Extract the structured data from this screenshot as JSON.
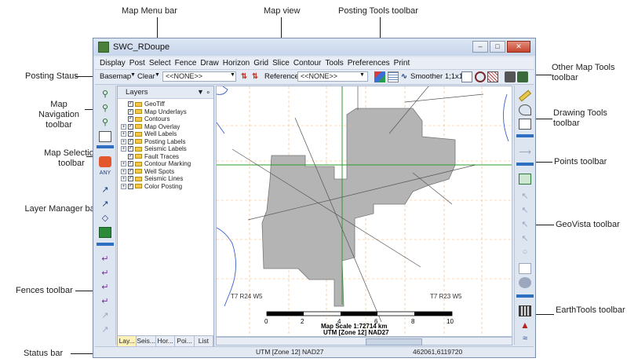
{
  "callouts": {
    "map_menu_bar": "Map Menu bar",
    "map_view": "Map view",
    "posting_tools_toolbar": "Posting Tools toolbar",
    "other_map_tools_toolbar": "Other Map Tools toolbar",
    "posting_status": "Posting Staus",
    "map_navigation_toolbar": "Map Navigation toolbar",
    "drawing_tools_toolbar": "Drawing Tools toolbar",
    "map_selection_toolbar": "Map Selection toolbar",
    "points_toolbar": "Points toolbar",
    "layer_manager_bar": "Layer Manager bar",
    "geovista_toolbar": "GeoVista toolbar",
    "fences_toolbar": "Fences toolbar",
    "earthtools_toolbar": "EarthTools toolbar",
    "status_bar": "Status bar"
  },
  "window": {
    "title": "SWC_RDoupe"
  },
  "menu": [
    "Display",
    "Post",
    "Select",
    "Fence",
    "Draw",
    "Horizon",
    "Grid",
    "Slice",
    "Contour",
    "Tools",
    "Preferences",
    "Print"
  ],
  "posting_bar": {
    "basemap": "Basemap",
    "clear": "Clear",
    "none_left": "<<NONE>>",
    "reference_label": "Reference:",
    "none_right": "<<NONE>>",
    "smoother": "Smoother 1;1x1"
  },
  "layers": {
    "title": "Layers",
    "items": [
      {
        "label": "GeoTiff",
        "expandable": false
      },
      {
        "label": "Map Underlays",
        "expandable": false
      },
      {
        "label": "Contours",
        "expandable": false
      },
      {
        "label": "Map Overlay",
        "expandable": true
      },
      {
        "label": "Well Labels",
        "expandable": true
      },
      {
        "label": "Posting Labels",
        "expandable": true
      },
      {
        "label": "Seismic Labels",
        "expandable": true
      },
      {
        "label": "Fault Traces",
        "expandable": false
      },
      {
        "label": "Contour Marking",
        "expandable": true
      },
      {
        "label": "Well Spots",
        "expandable": true
      },
      {
        "label": "Seismic Lines",
        "expandable": true
      },
      {
        "label": "Color Posting",
        "expandable": true
      }
    ],
    "tabs": [
      "Lay...",
      "Seis...",
      "Hor...",
      "Poi...",
      "List"
    ]
  },
  "map": {
    "township_left": "T7 R24 W5",
    "township_right": "T7 R23 W5",
    "scale_ticks": [
      "0",
      "2",
      "4",
      "6",
      "8",
      "10"
    ],
    "scale_text": "Map Scale 1:72714 km",
    "projection_text": "UTM [Zone 12] NAD27"
  },
  "status": {
    "projection": "UTM [Zone 12] NAD27",
    "coords": "462061,6119720"
  },
  "colors": {
    "accent": "#2f6fc2",
    "polygon_fill": "#b4b4b4",
    "grid_line": "#f0b27a",
    "green_line": "#2f9a2f"
  }
}
